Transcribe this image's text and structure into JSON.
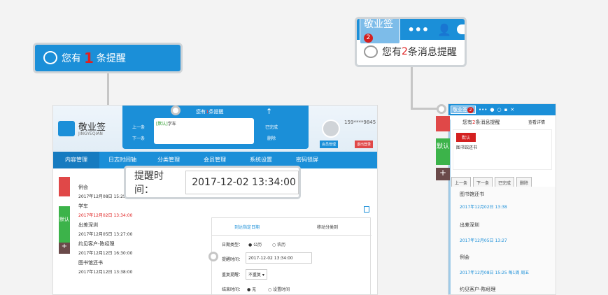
{
  "callout_main": {
    "prefix": "您有",
    "count": "1",
    "suffix": "条提醒"
  },
  "callout_widget": {
    "logo": "敬业签",
    "badge": "2",
    "prefix": "您有",
    "count": "2",
    "suffix": "条消息提醒"
  },
  "app": {
    "brand": "敬业签",
    "brand_sub": "JINGYEQIAN",
    "popup": {
      "prefix": "您有",
      "count": "1",
      "suffix": "条提醒",
      "prev": "上一条",
      "next": "下一条",
      "note_tag": "[默认]",
      "note_text": "学车",
      "done": "已完成",
      "delete": "删除"
    },
    "phone": "159****9845",
    "member_btn": "会员管理",
    "logout_btn": "退出登录",
    "nav": [
      "内容管理",
      "日志时间轴",
      "分类管理",
      "会员管理",
      "系统设置",
      "密码锁屏"
    ],
    "notes": [
      {
        "title": "例会",
        "time": "2017年12月08日 15:25:0"
      },
      {
        "title": "学车",
        "time": "2017年12月02日 13:34:00"
      },
      {
        "title": "出差深圳",
        "time": "2017年12月05日 13:27:00"
      },
      {
        "title": "约见客户-陈经理",
        "time": "2017年12月12日 16:30:00"
      },
      {
        "title": "图书馆还书",
        "time": "2017年12月12日 13:38:00"
      }
    ],
    "side_tab": "默认",
    "form": {
      "tab1": "到达指定日期",
      "tab2": "移动分类到",
      "date_type_label": "日期类型：",
      "opt_solar": "公历",
      "opt_lunar": "农历",
      "remind_label": "提醒时间：",
      "remind_value": "2017-12-02 13:34:00",
      "repeat_label": "重复提醒：",
      "repeat_value": "不重复",
      "end_label": "结束时间：",
      "end_none": "无",
      "end_set": "设置时间"
    }
  },
  "time_callout": {
    "label": "提醒时间：",
    "value": "2017-12-02 13:34:00"
  },
  "widget": {
    "logo": "敬业签",
    "badge": "2",
    "msg_prefix": "您有",
    "msg_count": "2",
    "msg_suffix": "条消息提醒",
    "view_details": "查看详情",
    "category": "默认",
    "note_text": "图书馆还书",
    "side_tab": "默认",
    "buttons": [
      "上一条",
      "下一条",
      "已完成",
      "删除"
    ],
    "items": [
      {
        "title": "图书馆还书",
        "time": "2017年12月02日 13:38"
      },
      {
        "title": "出差深圳",
        "time": "2017年12月05日 13:27"
      },
      {
        "title": "例会",
        "time": "2017年12月08日 15:25 每1周 周五"
      },
      {
        "title": "约见客户-陈经理",
        "time": ""
      }
    ]
  }
}
